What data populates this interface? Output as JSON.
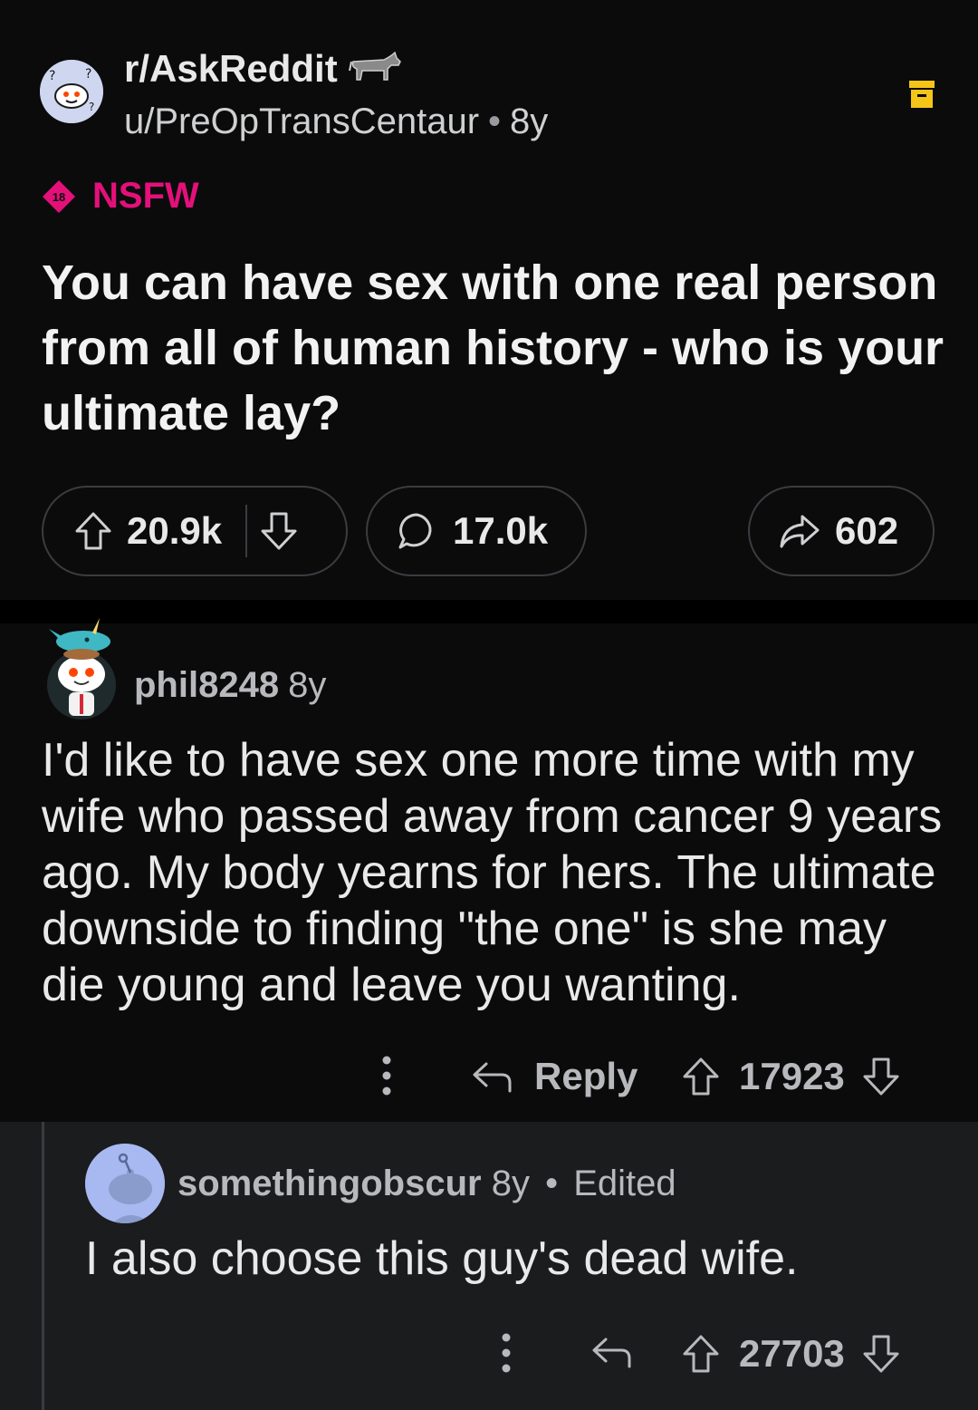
{
  "post": {
    "subreddit": "r/AskReddit",
    "author": "u/PreOpTransCentaur",
    "age": "8y",
    "nsfw_badge": "18",
    "nsfw_label": "NSFW",
    "title": "You can have sex with one real person from all of human history - who is your ultimate lay?",
    "upvotes": "20.9k",
    "comments": "17.0k",
    "shares": "602"
  },
  "comments": [
    {
      "author": "phil8248",
      "age": "8y",
      "body": "I'd like to have sex one more time with my wife who passed away from cancer 9 years ago. My body yearns for hers. The ultimate downside to finding \"the one\" is she may die young and leave you wanting.",
      "reply_label": "Reply",
      "score": "17923"
    },
    {
      "author": "somethingobscur",
      "age": "8y",
      "edited": "Edited",
      "body": "I also choose this guy's dead wife.",
      "score": "27703"
    }
  ],
  "colors": {
    "background": "#0b0b0c",
    "nested_background": "#1b1c1e",
    "nsfw": "#e4107a",
    "muted_text": "#b8b9bd"
  },
  "icons": [
    "subreddit-avatar-icon",
    "donkey-flair-icon",
    "archive-icon",
    "nsfw-badge-icon",
    "upvote-icon",
    "downvote-icon",
    "comment-icon",
    "share-icon",
    "more-options-icon",
    "reply-icon",
    "user-avatar-icon"
  ]
}
